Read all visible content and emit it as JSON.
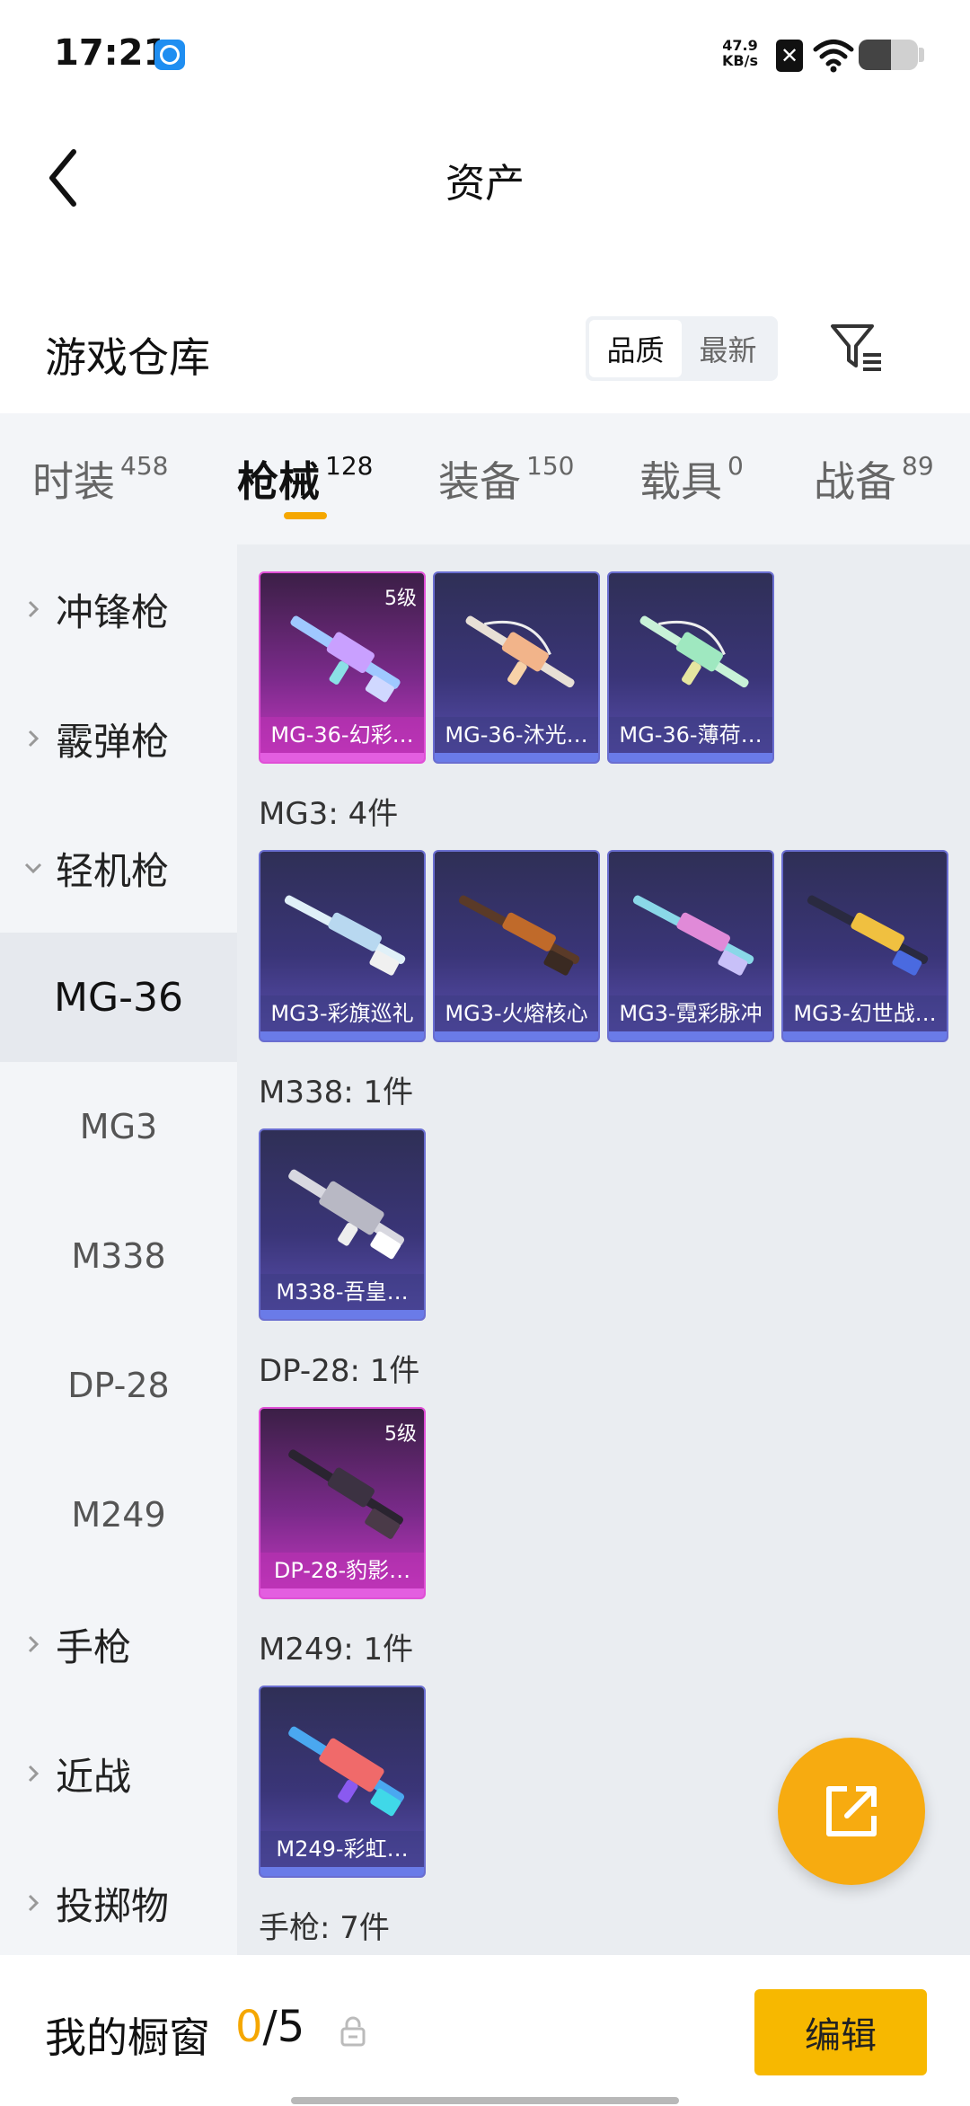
{
  "status_bar": {
    "time": "17:21",
    "speed_value": "47.9",
    "speed_unit": "KB/s",
    "battery_level": 0.55
  },
  "header": {
    "title": "资产",
    "back_icon": "chevron-left-icon"
  },
  "warehouse": {
    "title": "游戏仓库",
    "sort_options": [
      "品质",
      "最新"
    ],
    "sort_selected": "品质",
    "filter_icon": "filter-icon"
  },
  "tabs": [
    {
      "label": "时装",
      "count": "458"
    },
    {
      "label": "枪械",
      "count": "128"
    },
    {
      "label": "装备",
      "count": "150"
    },
    {
      "label": "载具",
      "count": "0"
    },
    {
      "label": "战备",
      "count": "89"
    }
  ],
  "active_tab": "枪械",
  "sidebar": {
    "items": [
      {
        "label": "冲锋枪"
      },
      {
        "label": "霰弹枪"
      },
      {
        "label": "轻机枪"
      },
      {
        "label": "MG-36"
      },
      {
        "label": "MG3"
      },
      {
        "label": "M338"
      },
      {
        "label": "DP-28"
      },
      {
        "label": "M249"
      },
      {
        "label": "手枪"
      },
      {
        "label": "近战"
      },
      {
        "label": "投掷物"
      }
    ],
    "active": "MG-36"
  },
  "groups": {
    "mg36": {
      "items": [
        {
          "name": "MG-36-幻彩…",
          "level": "5级"
        },
        {
          "name": "MG-36-沐光…"
        },
        {
          "name": "MG-36-薄荷…"
        }
      ]
    },
    "mg3": {
      "label": "MG3: 4件",
      "items": [
        {
          "name": "MG3-彩旗巡礼"
        },
        {
          "name": "MG3-火熔核心"
        },
        {
          "name": "MG3-霓彩脉冲"
        },
        {
          "name": "MG3-幻世战…"
        }
      ]
    },
    "m338": {
      "label": "M338: 1件",
      "items": [
        {
          "name": "M338-吾皇…"
        }
      ]
    },
    "dp28": {
      "label": "DP-28: 1件",
      "items": [
        {
          "name": "DP-28-豹影…",
          "level": "5级"
        }
      ]
    },
    "m249": {
      "label": "M249: 1件",
      "items": [
        {
          "name": "M249-彩虹…"
        }
      ]
    },
    "pistol": {
      "label": "手枪: 7件"
    }
  },
  "bottom": {
    "showcase_label": "我的橱窗",
    "used": "0",
    "total": "/5",
    "edit_label": "编辑",
    "lock_icon": "lock-icon",
    "share_icon": "share-icon"
  },
  "colors": {
    "accent": "#f5a700",
    "card_purple": "#3a3578",
    "card_gold": "#c538c0"
  }
}
